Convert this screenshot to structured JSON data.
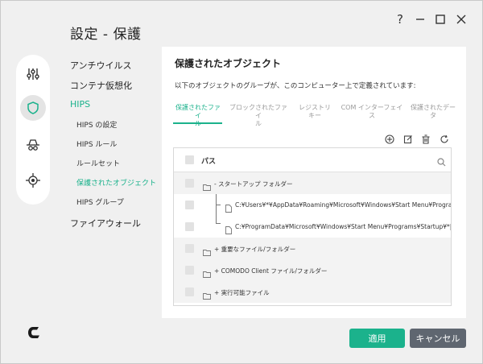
{
  "window": {
    "title": "設定 - 保護",
    "help_icon": "question-mark",
    "minimize_icon": "minimize",
    "maximize_icon": "maximize",
    "close_icon": "close"
  },
  "rail": {
    "icons": [
      "sliders-icon",
      "shield-icon",
      "spy-icon",
      "virus-scope-icon"
    ],
    "active_index": 1
  },
  "nav": {
    "antivirus": "アンチウイルス",
    "containment": "コンテナ仮想化",
    "hips": "HIPS",
    "hips_settings": "HIPS の設定",
    "hips_rules": "HIPS ルール",
    "rulesets": "ルールセット",
    "protected_objects": "保護されたオブジェクト",
    "hips_groups": "HIPS グループ",
    "firewall": "ファイアウォール"
  },
  "panel": {
    "title": "保護されたオブジェクト",
    "description": "以下のオブジェクトのグループが、このコンピューター上で定義されています:",
    "tabs": [
      {
        "line1": "保護されたファイ",
        "line2": "ル"
      },
      {
        "line1": "ブロックされたファイ",
        "line2": "ル"
      },
      {
        "line1": "レジストリ",
        "line2": "キー"
      },
      {
        "line1": "COM インターフェイ",
        "line2": "ス"
      },
      {
        "line1": "保護されたデー",
        "line2": "タ"
      }
    ],
    "active_tab": 0,
    "toolbar": [
      "add-icon",
      "edit-icon",
      "delete-icon",
      "refresh-icon"
    ]
  },
  "table": {
    "header": "パス",
    "rows": [
      {
        "text": "- スタートアップ フォルダー",
        "type": "folder"
      },
      {
        "text": "C:¥Users¥*¥AppData¥Roaming¥Microsoft¥Windows¥Start Menu¥Programs¥St...",
        "type": "file"
      },
      {
        "text": "C:¥ProgramData¥Microsoft¥Windows¥Start Menu¥Programs¥Startup¥*|",
        "type": "file"
      },
      {
        "text": "+ 重要なファイル/フォルダー",
        "type": "folder"
      },
      {
        "text": "+ COMODO Client ファイル/フォルダー",
        "type": "folder"
      },
      {
        "text": "+ 実行可能ファイル",
        "type": "folder"
      }
    ]
  },
  "buttons": {
    "apply": "適用",
    "cancel": "キャンセル"
  },
  "colors": {
    "accent": "#1bb28c",
    "cancel_button": "#5f6670"
  }
}
